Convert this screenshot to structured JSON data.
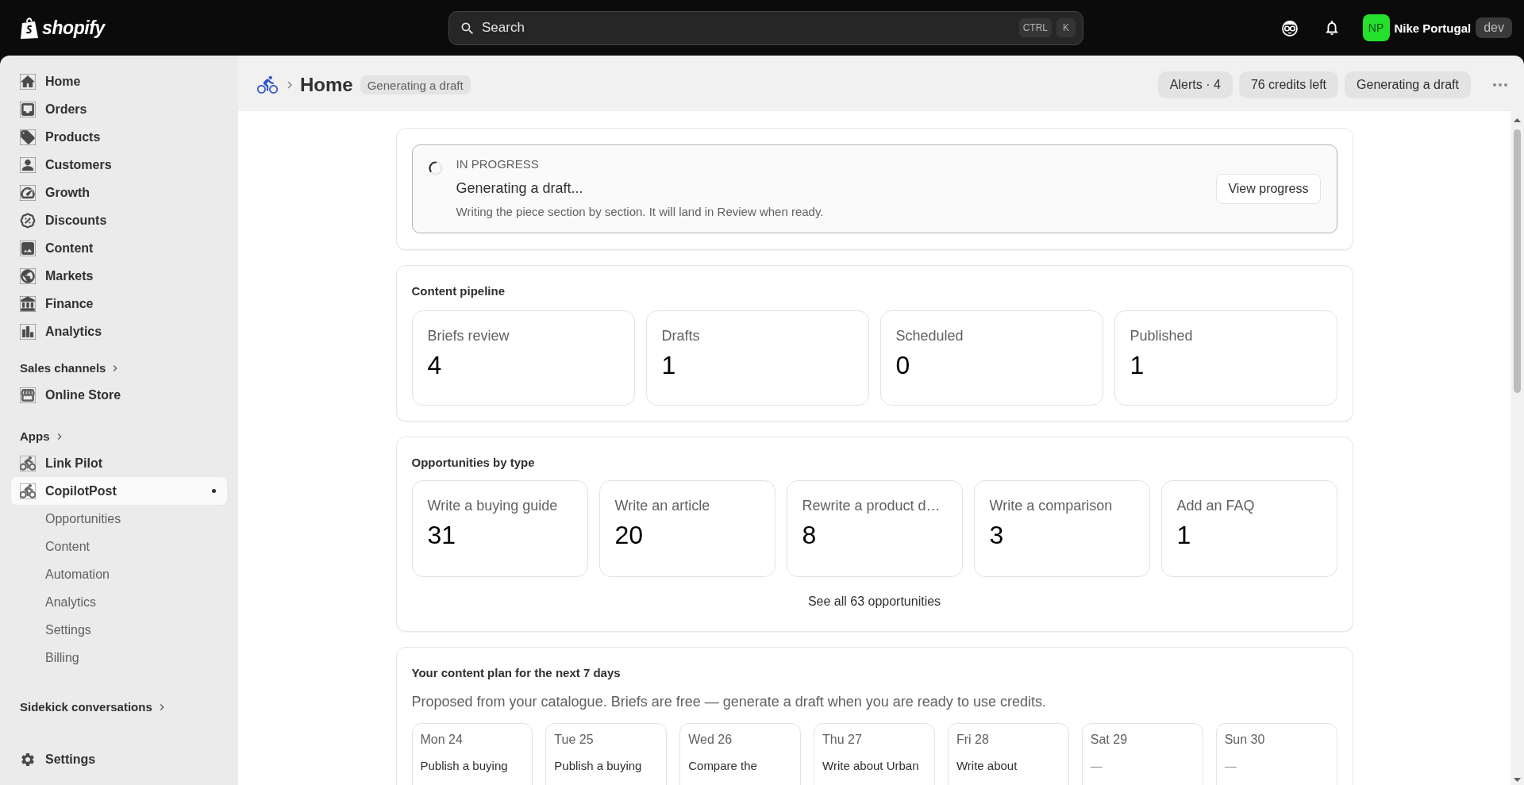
{
  "top_bar": {
    "logo": "shopify",
    "search": {
      "placeholder": "Search",
      "shortcut": [
        "CTRL",
        "K"
      ]
    },
    "store": {
      "initials": "NP",
      "name": "Nike Portugal",
      "badge": "dev"
    }
  },
  "sidebar": {
    "nav": [
      {
        "label": "Home",
        "selected": false
      },
      {
        "label": "Orders",
        "selected": false
      },
      {
        "label": "Products",
        "selected": false
      },
      {
        "label": "Customers",
        "selected": false
      },
      {
        "label": "Growth",
        "selected": false
      },
      {
        "label": "Discounts",
        "selected": false
      },
      {
        "label": "Content",
        "selected": false
      },
      {
        "label": "Markets",
        "selected": false
      },
      {
        "label": "Finance",
        "selected": false
      },
      {
        "label": "Analytics",
        "selected": false
      }
    ],
    "sections": [
      {
        "title": "Sales channels",
        "items": [
          {
            "label": "Online Store",
            "selected": false
          }
        ]
      },
      {
        "title": "Apps",
        "items": [
          {
            "label": "Link Pilot",
            "selected": false
          },
          {
            "label": "CopilotPost",
            "selected": true,
            "children": [
              {
                "label": "Opportunities",
                "selected": false
              },
              {
                "label": "Content",
                "selected": false
              },
              {
                "label": "Automation",
                "selected": false
              },
              {
                "label": "Analytics",
                "selected": false
              },
              {
                "label": "Settings",
                "selected": false
              },
              {
                "label": "Billing",
                "selected": false
              }
            ]
          }
        ]
      }
    ],
    "sidekick": {
      "title": "Sidekick conversations"
    },
    "footer": {
      "label": "Settings",
      "selected": false
    }
  },
  "page_header": {
    "title": "Home",
    "status": "Generating a draft",
    "actions": [
      "Alerts · 4",
      "76 credits left",
      "Generating a draft"
    ]
  },
  "progress": {
    "eyebrow": "IN PROGRESS",
    "title": "Generating a draft...",
    "description": "Writing the piece section by section. It will land in Review when ready.",
    "button": "View progress"
  },
  "pipeline": {
    "title": "Content pipeline",
    "stats": [
      {
        "label": "Briefs review",
        "value": "4"
      },
      {
        "label": "Drafts",
        "value": "1"
      },
      {
        "label": "Scheduled",
        "value": "0"
      },
      {
        "label": "Published",
        "value": "1"
      }
    ]
  },
  "opportunities": {
    "title": "Opportunities by type",
    "types": [
      {
        "label": "Write a buying guide",
        "value": "31"
      },
      {
        "label": "Write an article",
        "value": "20"
      },
      {
        "label": "Rewrite a product d…",
        "value": "8"
      },
      {
        "label": "Write a comparison",
        "value": "3"
      },
      {
        "label": "Add an FAQ",
        "value": "1"
      }
    ],
    "link": "See all 63 opportunities"
  },
  "content_plan": {
    "title": "Your content plan for the next 7 days",
    "subtitle": "Proposed from your catalogue. Briefs are free — generate a draft when you are ready to use credits.",
    "days": [
      {
        "date": "Mon 24",
        "kind": "brief",
        "text": "Publish a buying"
      },
      {
        "date": "Tue 25",
        "kind": "brief",
        "text": "Publish a buying"
      },
      {
        "date": "Wed 26",
        "kind": "brief",
        "text": "Compare the"
      },
      {
        "date": "Thu 27",
        "kind": "brief",
        "text": "Write about Urban"
      },
      {
        "date": "Fri 28",
        "kind": "brief",
        "text": "Write about"
      },
      {
        "date": "Sat 29",
        "kind": "empty",
        "text": "—"
      },
      {
        "date": "Sun 30",
        "kind": "empty",
        "text": "—"
      }
    ]
  }
}
